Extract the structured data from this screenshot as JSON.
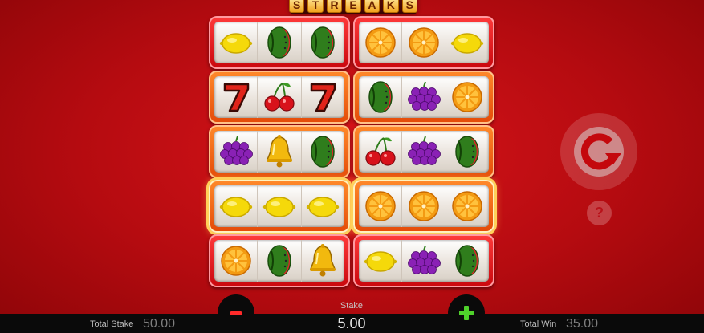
{
  "title": {
    "letters": [
      "S",
      "T",
      "R",
      "E",
      "A",
      "K",
      "S"
    ]
  },
  "machines": [
    {
      "reels": [
        "lemon-icon",
        "watermelon-icon",
        "watermelon-icon"
      ]
    },
    {
      "reels": [
        "orange-icon",
        "orange-icon",
        "lemon-icon"
      ]
    },
    {
      "reels": [
        "seven-icon",
        "cherry-icon",
        "seven-icon"
      ]
    },
    {
      "reels": [
        "watermelon-icon",
        "grapes-icon",
        "orange-icon"
      ]
    },
    {
      "reels": [
        "grapes-icon",
        "bell-icon",
        "watermelon-icon"
      ]
    },
    {
      "reels": [
        "cherry-icon",
        "grapes-icon",
        "watermelon-icon"
      ]
    },
    {
      "reels": [
        "lemon-icon",
        "lemon-icon",
        "lemon-icon"
      ]
    },
    {
      "reels": [
        "orange-icon",
        "orange-icon",
        "orange-icon"
      ]
    },
    {
      "reels": [
        "orange-icon",
        "watermelon-icon",
        "bell-icon"
      ]
    },
    {
      "reels": [
        "lemon-icon",
        "grapes-icon",
        "watermelon-icon"
      ]
    }
  ],
  "controls": {
    "help_label": "?",
    "spin_icon": "spin-icon",
    "minus_icon": "minus-icon",
    "plus_icon": "plus-icon"
  },
  "footer": {
    "total_stake_label": "Total Stake",
    "total_stake_value": "50.00",
    "stake_label": "Stake",
    "stake_value": "5.00",
    "total_win_label": "Total Win",
    "total_win_value": "35.00"
  },
  "colors": {
    "background": "#c4080d",
    "accent_red": "#ff2a2a",
    "accent_green": "#4fd12b"
  }
}
